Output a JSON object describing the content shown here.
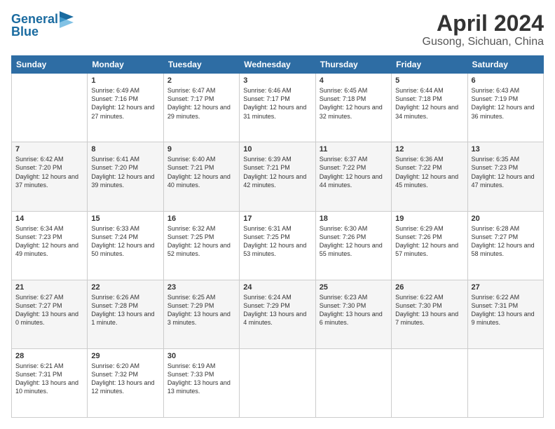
{
  "header": {
    "logo_line1": "General",
    "logo_line2": "Blue",
    "title": "April 2024",
    "subtitle": "Gusong, Sichuan, China"
  },
  "calendar": {
    "days_of_week": [
      "Sunday",
      "Monday",
      "Tuesday",
      "Wednesday",
      "Thursday",
      "Friday",
      "Saturday"
    ],
    "weeks": [
      [
        {
          "day": "",
          "info": ""
        },
        {
          "day": "1",
          "info": "Sunrise: 6:49 AM\nSunset: 7:16 PM\nDaylight: 12 hours\nand 27 minutes."
        },
        {
          "day": "2",
          "info": "Sunrise: 6:47 AM\nSunset: 7:17 PM\nDaylight: 12 hours\nand 29 minutes."
        },
        {
          "day": "3",
          "info": "Sunrise: 6:46 AM\nSunset: 7:17 PM\nDaylight: 12 hours\nand 31 minutes."
        },
        {
          "day": "4",
          "info": "Sunrise: 6:45 AM\nSunset: 7:18 PM\nDaylight: 12 hours\nand 32 minutes."
        },
        {
          "day": "5",
          "info": "Sunrise: 6:44 AM\nSunset: 7:18 PM\nDaylight: 12 hours\nand 34 minutes."
        },
        {
          "day": "6",
          "info": "Sunrise: 6:43 AM\nSunset: 7:19 PM\nDaylight: 12 hours\nand 36 minutes."
        }
      ],
      [
        {
          "day": "7",
          "info": "Sunrise: 6:42 AM\nSunset: 7:20 PM\nDaylight: 12 hours\nand 37 minutes."
        },
        {
          "day": "8",
          "info": "Sunrise: 6:41 AM\nSunset: 7:20 PM\nDaylight: 12 hours\nand 39 minutes."
        },
        {
          "day": "9",
          "info": "Sunrise: 6:40 AM\nSunset: 7:21 PM\nDaylight: 12 hours\nand 40 minutes."
        },
        {
          "day": "10",
          "info": "Sunrise: 6:39 AM\nSunset: 7:21 PM\nDaylight: 12 hours\nand 42 minutes."
        },
        {
          "day": "11",
          "info": "Sunrise: 6:37 AM\nSunset: 7:22 PM\nDaylight: 12 hours\nand 44 minutes."
        },
        {
          "day": "12",
          "info": "Sunrise: 6:36 AM\nSunset: 7:22 PM\nDaylight: 12 hours\nand 45 minutes."
        },
        {
          "day": "13",
          "info": "Sunrise: 6:35 AM\nSunset: 7:23 PM\nDaylight: 12 hours\nand 47 minutes."
        }
      ],
      [
        {
          "day": "14",
          "info": "Sunrise: 6:34 AM\nSunset: 7:23 PM\nDaylight: 12 hours\nand 49 minutes."
        },
        {
          "day": "15",
          "info": "Sunrise: 6:33 AM\nSunset: 7:24 PM\nDaylight: 12 hours\nand 50 minutes."
        },
        {
          "day": "16",
          "info": "Sunrise: 6:32 AM\nSunset: 7:25 PM\nDaylight: 12 hours\nand 52 minutes."
        },
        {
          "day": "17",
          "info": "Sunrise: 6:31 AM\nSunset: 7:25 PM\nDaylight: 12 hours\nand 53 minutes."
        },
        {
          "day": "18",
          "info": "Sunrise: 6:30 AM\nSunset: 7:26 PM\nDaylight: 12 hours\nand 55 minutes."
        },
        {
          "day": "19",
          "info": "Sunrise: 6:29 AM\nSunset: 7:26 PM\nDaylight: 12 hours\nand 57 minutes."
        },
        {
          "day": "20",
          "info": "Sunrise: 6:28 AM\nSunset: 7:27 PM\nDaylight: 12 hours\nand 58 minutes."
        }
      ],
      [
        {
          "day": "21",
          "info": "Sunrise: 6:27 AM\nSunset: 7:27 PM\nDaylight: 13 hours\nand 0 minutes."
        },
        {
          "day": "22",
          "info": "Sunrise: 6:26 AM\nSunset: 7:28 PM\nDaylight: 13 hours\nand 1 minute."
        },
        {
          "day": "23",
          "info": "Sunrise: 6:25 AM\nSunset: 7:29 PM\nDaylight: 13 hours\nand 3 minutes."
        },
        {
          "day": "24",
          "info": "Sunrise: 6:24 AM\nSunset: 7:29 PM\nDaylight: 13 hours\nand 4 minutes."
        },
        {
          "day": "25",
          "info": "Sunrise: 6:23 AM\nSunset: 7:30 PM\nDaylight: 13 hours\nand 6 minutes."
        },
        {
          "day": "26",
          "info": "Sunrise: 6:22 AM\nSunset: 7:30 PM\nDaylight: 13 hours\nand 7 minutes."
        },
        {
          "day": "27",
          "info": "Sunrise: 6:22 AM\nSunset: 7:31 PM\nDaylight: 13 hours\nand 9 minutes."
        }
      ],
      [
        {
          "day": "28",
          "info": "Sunrise: 6:21 AM\nSunset: 7:31 PM\nDaylight: 13 hours\nand 10 minutes."
        },
        {
          "day": "29",
          "info": "Sunrise: 6:20 AM\nSunset: 7:32 PM\nDaylight: 13 hours\nand 12 minutes."
        },
        {
          "day": "30",
          "info": "Sunrise: 6:19 AM\nSunset: 7:33 PM\nDaylight: 13 hours\nand 13 minutes."
        },
        {
          "day": "",
          "info": ""
        },
        {
          "day": "",
          "info": ""
        },
        {
          "day": "",
          "info": ""
        },
        {
          "day": "",
          "info": ""
        }
      ]
    ]
  }
}
